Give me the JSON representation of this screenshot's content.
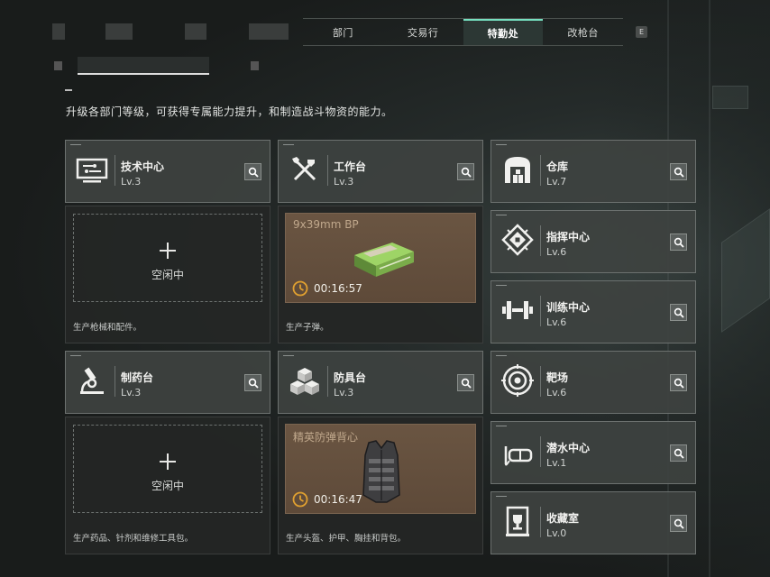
{
  "nav": {
    "tabs": [
      {
        "label": "部门",
        "active": false
      },
      {
        "label": "交易行",
        "active": false
      },
      {
        "label": "特勤处",
        "active": true
      },
      {
        "label": "改枪台",
        "active": false
      }
    ],
    "key_hint": "E"
  },
  "intro_text": "升级各部门等级，可获得专属能力提升，和制造战斗物资的能力。",
  "workshops": [
    {
      "name": "技术中心",
      "level": "Lv.3",
      "icon": "computer-icon",
      "production": {
        "status": "idle",
        "idle_label": "空闲中",
        "description": "生产枪械和配件。"
      }
    },
    {
      "name": "工作台",
      "level": "Lv.3",
      "icon": "tools-icon",
      "production": {
        "status": "active",
        "item_name": "9x39mm BP",
        "item_icon": "ammo-box-icon",
        "timer": "00:16:57",
        "description": "生产子弹。"
      }
    },
    {
      "name": "制药台",
      "level": "Lv.3",
      "icon": "microscope-icon",
      "production": {
        "status": "idle",
        "idle_label": "空闲中",
        "description": "生产药品、针剂和维修工具包。"
      }
    },
    {
      "name": "防具台",
      "level": "Lv.3",
      "icon": "armor-blocks-icon",
      "production": {
        "status": "active",
        "item_name": "精英防弹背心",
        "item_icon": "vest-icon",
        "timer": "00:16:47",
        "description": "生产头盔、护甲、胸挂和背包。"
      }
    }
  ],
  "facilities": [
    {
      "name": "仓库",
      "level": "Lv.7",
      "icon": "warehouse-icon"
    },
    {
      "name": "指挥中心",
      "level": "Lv.6",
      "icon": "chip-icon"
    },
    {
      "name": "训练中心",
      "level": "Lv.6",
      "icon": "dumbbell-icon"
    },
    {
      "name": "靶场",
      "level": "Lv.6",
      "icon": "target-icon"
    },
    {
      "name": "潜水中心",
      "level": "Lv.1",
      "icon": "diving-mask-icon"
    },
    {
      "name": "收藏室",
      "level": "Lv.0",
      "icon": "trophy-icon"
    }
  ],
  "colors": {
    "accent": "#76e0c0",
    "timer_icon": "#e0a030",
    "active_bg": "#6a5542"
  }
}
